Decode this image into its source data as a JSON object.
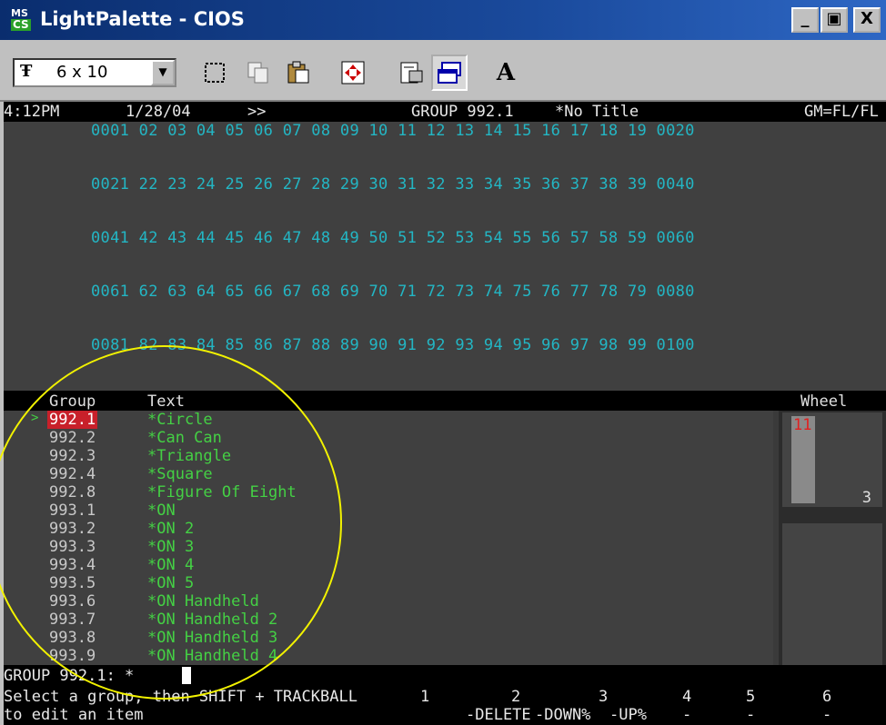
{
  "window": {
    "title": "LightPalette - CIOS",
    "icon_text_top": "MS",
    "icon_text_bottom": "CS",
    "buttons": {
      "minimize": "_",
      "maximize": "▣",
      "close": "X"
    }
  },
  "toolbar": {
    "font_icon": "Ŧ",
    "font_size": "6 x 10",
    "bold_a": "A",
    "icons": [
      "select-rect-icon",
      "copy-icon",
      "paste-icon",
      "fullscreen-icon",
      "properties-icon",
      "window-icon",
      "font-icon"
    ]
  },
  "status": {
    "time": "4:12PM",
    "date": "1/28/04",
    "arrows": ">>",
    "group": "GROUP 992.1",
    "title": "*No Title",
    "gm": "GM=FL/FL"
  },
  "channels": [
    "0001 02 03 04 05 06 07 08 09 10 11 12 13 14 15 16 17 18 19 0020",
    "0021 22 23 24 25 26 27 28 29 30 31 32 33 34 35 36 37 38 39 0040",
    "0041 42 43 44 45 46 47 48 49 50 51 52 53 54 55 56 57 58 59 0060",
    "0061 62 63 64 65 66 67 68 69 70 71 72 73 74 75 76 77 78 79 0080",
    "0081 82 83 84 85 86 87 88 89 90 91 92 93 94 95 96 97 98 99 0100"
  ],
  "list_header": {
    "group": "Group",
    "text": "Text",
    "wheel": "Wheel"
  },
  "groups": [
    {
      "id": "992.1",
      "text": "*Circle"
    },
    {
      "id": "992.2",
      "text": "*Can Can"
    },
    {
      "id": "992.3",
      "text": "*Triangle"
    },
    {
      "id": "992.4",
      "text": "*Square"
    },
    {
      "id": "992.8",
      "text": "*Figure Of Eight"
    },
    {
      "id": "993.1",
      "text": "*ON"
    },
    {
      "id": "993.2",
      "text": "*ON 2"
    },
    {
      "id": "993.3",
      "text": "*ON 3"
    },
    {
      "id": "993.4",
      "text": "*ON 4"
    },
    {
      "id": "993.5",
      "text": "*ON 5"
    },
    {
      "id": "993.6",
      "text": "*ON Handheld"
    },
    {
      "id": "993.7",
      "text": "*ON Handheld 2"
    },
    {
      "id": "993.8",
      "text": "*ON Handheld 3"
    },
    {
      "id": "993.9",
      "text": "*ON Handheld 4"
    }
  ],
  "selected_cursor": ">",
  "wheel": {
    "marker": "11",
    "value": "3"
  },
  "command": "GROUP 992.1: *",
  "prompt": {
    "line1": "Select a group, then SHIFT + TRACKBALL",
    "line2": "to edit an item"
  },
  "softkeys": [
    {
      "num": "1",
      "label": "-DELETE"
    },
    {
      "num": "2",
      "label": "-DOWN%"
    },
    {
      "num": "3",
      "label": "-UP%"
    },
    {
      "num": "4",
      "label": "-"
    },
    {
      "num": "5",
      "label": "-"
    },
    {
      "num": "6",
      "label": "-"
    }
  ],
  "colors": {
    "channel": "#23b6c4",
    "group_text": "#44d044",
    "selected": "#c8202a",
    "highlight_circle": "#f2f200"
  }
}
